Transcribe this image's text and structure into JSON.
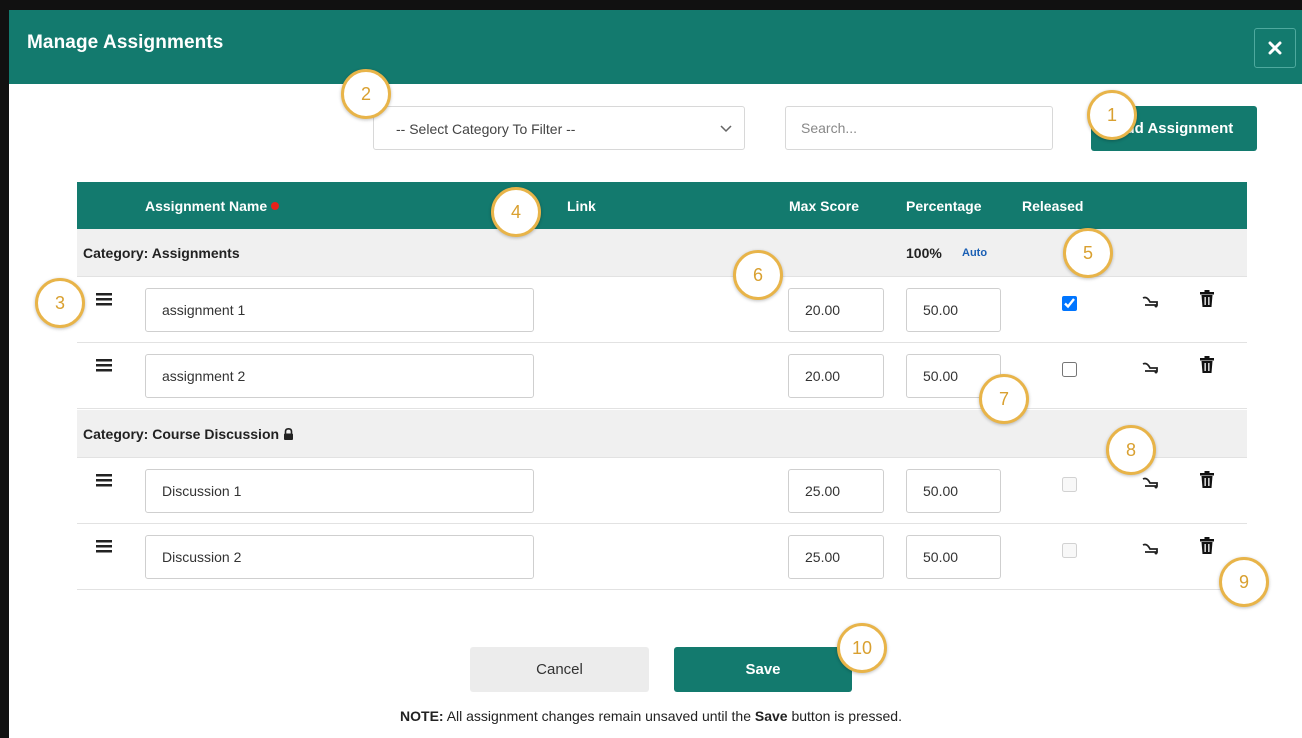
{
  "dialog": {
    "title": "Manage Assignments",
    "close_icon": "close-icon"
  },
  "toolbar": {
    "filter_select": "-- Select Category To Filter --",
    "search_placeholder": "Search...",
    "add_button": "Add Assignment"
  },
  "table": {
    "columns": {
      "name": "Assignment Name",
      "link": "Link",
      "max_score": "Max Score",
      "percentage": "Percentage",
      "released": "Released"
    },
    "categories": [
      {
        "label": "Category: Assignments",
        "percentage": "100%",
        "auto": "Auto",
        "locked": false,
        "rows": [
          {
            "name": "assignment 1",
            "max_score": "20.00",
            "percentage": "50.00",
            "released": true,
            "disabled": false
          },
          {
            "name": "assignment 2",
            "max_score": "20.00",
            "percentage": "50.00",
            "released": false,
            "disabled": false
          }
        ]
      },
      {
        "label": "Category: Course Discussion",
        "locked": true,
        "rows": [
          {
            "name": "Discussion 1",
            "max_score": "25.00",
            "percentage": "50.00",
            "released": false,
            "disabled": true
          },
          {
            "name": "Discussion 2",
            "max_score": "25.00",
            "percentage": "50.00",
            "released": false,
            "disabled": true
          }
        ]
      }
    ]
  },
  "footer": {
    "cancel_button": "Cancel",
    "save_button": "Save",
    "note_prefix": "NOTE:",
    "note_text": " All assignment changes remain unsaved until the ",
    "note_bold": "Save",
    "note_suffix": " button is pressed."
  },
  "callouts": [
    "1",
    "2",
    "3",
    "4",
    "5",
    "6",
    "7",
    "8",
    "9",
    "10"
  ],
  "colors": {
    "brand": "#137a6e",
    "callout_border": "#e8b449",
    "required": "#e8211a",
    "auto_link": "#1a5fb4"
  }
}
